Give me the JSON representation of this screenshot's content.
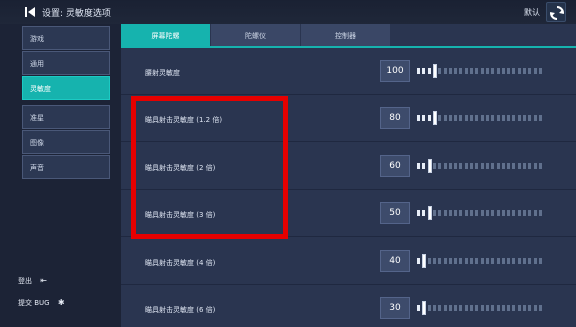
{
  "header": {
    "title": "设置: 灵敏度选项",
    "default_label": "默认",
    "back_icon": "back-arrow-icon",
    "reset_icon": "refresh-icon"
  },
  "sidebar": {
    "items": [
      {
        "label": "游戏",
        "active": false
      },
      {
        "label": "通用",
        "active": false
      },
      {
        "label": "灵敏度",
        "active": true
      },
      {
        "label": "准星",
        "active": false
      },
      {
        "label": "图像",
        "active": false
      },
      {
        "label": "声音",
        "active": false
      }
    ],
    "logout_label": "登出",
    "report_bug_label": "提交 BUG"
  },
  "tabs": [
    {
      "label": "屏幕陀螺",
      "active": true
    },
    {
      "label": "陀螺仪",
      "active": false
    },
    {
      "label": "控制器",
      "active": false
    }
  ],
  "settings": [
    {
      "label": "腰射灵敏度",
      "value": "100",
      "level": 0.14
    },
    {
      "label": "瞄具射击灵敏度 (1.2 倍)",
      "value": "80",
      "level": 0.12
    },
    {
      "label": "瞄具射击灵敏度 (2 倍)",
      "value": "60",
      "level": 0.09
    },
    {
      "label": "瞄具射击灵敏度 (3 倍)",
      "value": "50",
      "level": 0.08
    },
    {
      "label": "瞄具射击灵敏度 (4 倍)",
      "value": "40",
      "level": 0.06
    },
    {
      "label": "瞄具射击灵敏度 (6 倍)",
      "value": "30",
      "level": 0.04
    }
  ],
  "colors": {
    "accent": "#16b3ae",
    "highlight": "#e60000",
    "background": "#1c2336",
    "panel": "#2a3550"
  }
}
